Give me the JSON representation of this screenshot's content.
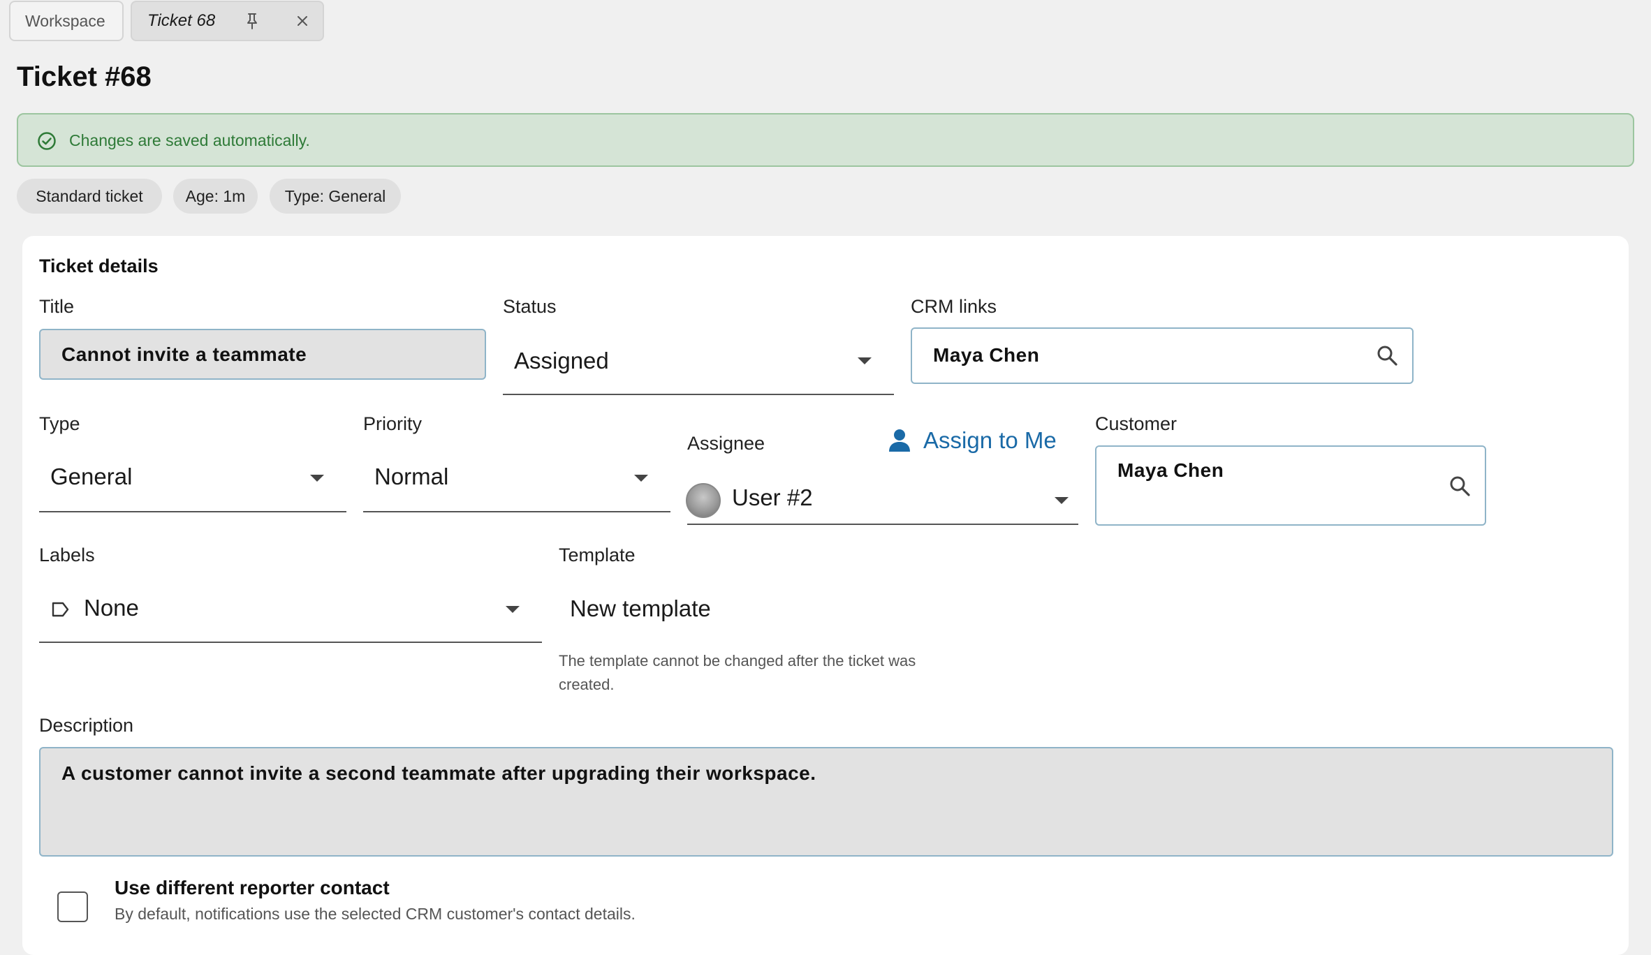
{
  "tabs": [
    {
      "label": "Workspace"
    },
    {
      "label": "Ticket 68"
    }
  ],
  "page": {
    "title": "Ticket #68"
  },
  "banner": {
    "text": "Changes are saved automatically."
  },
  "chips": [
    "Standard ticket",
    "Age: 1m",
    "Type: General"
  ],
  "details": {
    "section_title": "Ticket details",
    "title": {
      "label": "Title",
      "value": "Cannot invite a teammate"
    },
    "status": {
      "label": "Status",
      "value": "Assigned"
    },
    "crm_links": {
      "label": "CRM links",
      "value": "Maya Chen"
    },
    "type": {
      "label": "Type",
      "value": "General"
    },
    "priority": {
      "label": "Priority",
      "value": "Normal"
    },
    "assignee": {
      "label": "Assignee",
      "value": "User #2",
      "assign_to_me": "Assign to Me"
    },
    "customer": {
      "label": "Customer",
      "value": "Maya Chen"
    },
    "labels": {
      "label": "Labels",
      "value": "None"
    },
    "template": {
      "label": "Template",
      "value": "New template",
      "help": "The template cannot be changed after the ticket was created."
    },
    "description": {
      "label": "Description",
      "value": "A customer cannot invite a second teammate after upgrading their workspace."
    },
    "reporter": {
      "title": "Use different reporter contact",
      "subtitle": "By default, notifications use the selected CRM customer's contact details.",
      "checked": false
    }
  },
  "colors": {
    "accent": "#1a6aa7",
    "success_bg": "#d5e4d6",
    "success_text": "#2e7a37",
    "field_border": "#8fb4c8"
  },
  "icons": [
    "pin-icon",
    "close-icon",
    "check-circle-icon",
    "search-icon",
    "person-icon",
    "label-icon",
    "chevron-down-icon"
  ]
}
